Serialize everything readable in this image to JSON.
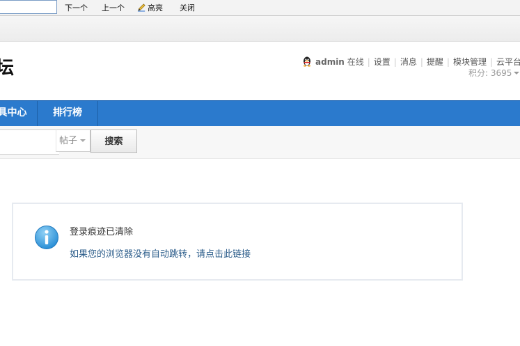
{
  "findbar": {
    "next_label": "下一个",
    "prev_label": "上一个",
    "highlight_label": "高亮",
    "close_label": "关闭"
  },
  "header": {
    "logo_fragment": "坛",
    "username": "admin",
    "status": "在线",
    "menu": [
      "设置",
      "消息",
      "提醒",
      "模块管理",
      "云平台"
    ],
    "points": "积分: 3695"
  },
  "nav": {
    "items": [
      "具中心",
      "排行榜"
    ],
    "accent": "#2b7acd"
  },
  "search": {
    "value": "",
    "type_label": "帖子",
    "button_label": "搜索"
  },
  "message": {
    "title": "登录痕迹已清除",
    "link_text": "如果您的浏览器没有自动跳转，请点击此链接",
    "icon": "info-icon"
  }
}
